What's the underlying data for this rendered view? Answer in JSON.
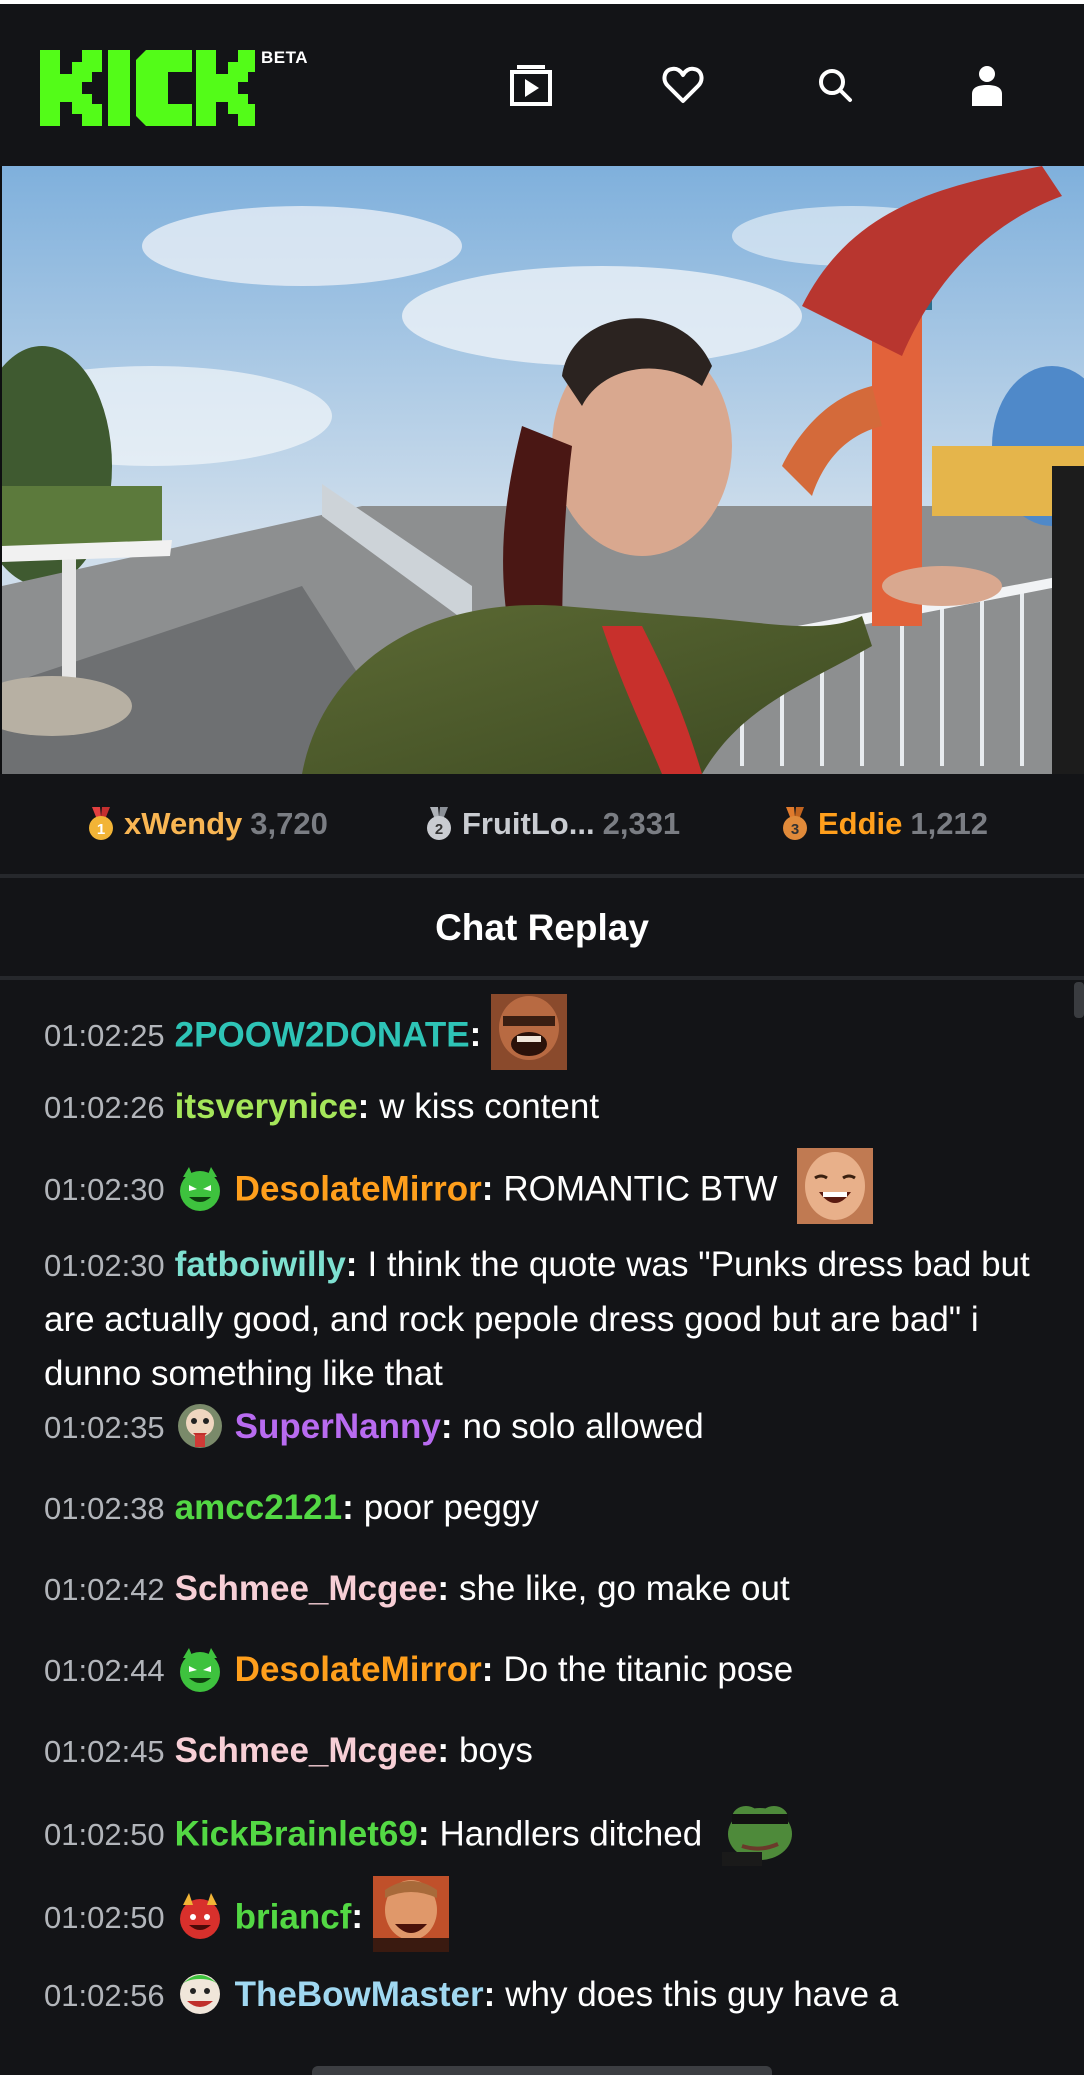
{
  "app": {
    "logo_text": "KICK",
    "beta_label": "BETA",
    "brand_color": "#53fc18"
  },
  "header_icons": [
    {
      "name": "videos-icon"
    },
    {
      "name": "heart-icon"
    },
    {
      "name": "search-icon"
    },
    {
      "name": "user-icon"
    }
  ],
  "leaderboard": [
    {
      "rank": "1",
      "name": "xWendy",
      "score": "3,720",
      "name_color": "#f9b653"
    },
    {
      "rank": "2",
      "name": "FruitLo...",
      "score": "2,331",
      "name_color": "#c9ccd1"
    },
    {
      "rank": "3",
      "name": "Eddie",
      "score": "1,212",
      "name_color": "#ff9f1c"
    }
  ],
  "chat": {
    "title": "Chat Replay",
    "messages": [
      {
        "time": "01:02:25",
        "user": "2POOW2DONATE",
        "color": "#2ec4b6",
        "text": "",
        "badge": "",
        "emote": "laughing-man-emote"
      },
      {
        "time": "01:02:26",
        "user": "itsverynice",
        "color": "#a5e65a",
        "text": "w kiss content",
        "badge": "",
        "emote": ""
      },
      {
        "time": "01:02:30",
        "user": "DesolateMirror",
        "color": "#ff9f1c",
        "text": "ROMANTIC BTW",
        "badge": "green-devil-badge",
        "emote": "laughing-face-emote"
      },
      {
        "time": "01:02:30",
        "user": "fatboiwilly",
        "color": "#7ee0d0",
        "text": "I think the quote was \"Punks dress bad but are actually good, and rock pepole dress good but are bad\" i dunno something like that",
        "badge": "",
        "emote": ""
      },
      {
        "time": "01:02:35",
        "user": "SuperNanny",
        "color": "#b86bf0",
        "text": "no solo allowed",
        "badge": "nanny-badge",
        "emote": ""
      },
      {
        "time": "01:02:38",
        "user": "amcc2121",
        "color": "#53d844",
        "text": "poor peggy",
        "badge": "",
        "emote": ""
      },
      {
        "time": "01:02:42",
        "user": "Schmee_Mcgee",
        "color": "#f7cfd6",
        "text": "she like, go make out",
        "badge": "",
        "emote": ""
      },
      {
        "time": "01:02:44",
        "user": "DesolateMirror",
        "color": "#ff9f1c",
        "text": "Do the titanic pose",
        "badge": "green-devil-badge",
        "emote": ""
      },
      {
        "time": "01:02:45",
        "user": "Schmee_Mcgee",
        "color": "#f7cfd6",
        "text": "boys",
        "badge": "",
        "emote": ""
      },
      {
        "time": "01:02:50",
        "user": "KickBrainlet69",
        "color": "#53d844",
        "text": "Handlers ditched",
        "badge": "",
        "emote": "pepe-sunglasses-emote"
      },
      {
        "time": "01:02:50",
        "user": "briancf",
        "color": "#53d844",
        "text": "",
        "badge": "red-devil-badge",
        "emote": "leo-laugh-emote"
      },
      {
        "time": "01:02:56",
        "user": "TheBowMaster",
        "color": "#a0d8f1",
        "text": "why does this guy have a",
        "badge": "joker-badge",
        "emote": ""
      }
    ]
  }
}
